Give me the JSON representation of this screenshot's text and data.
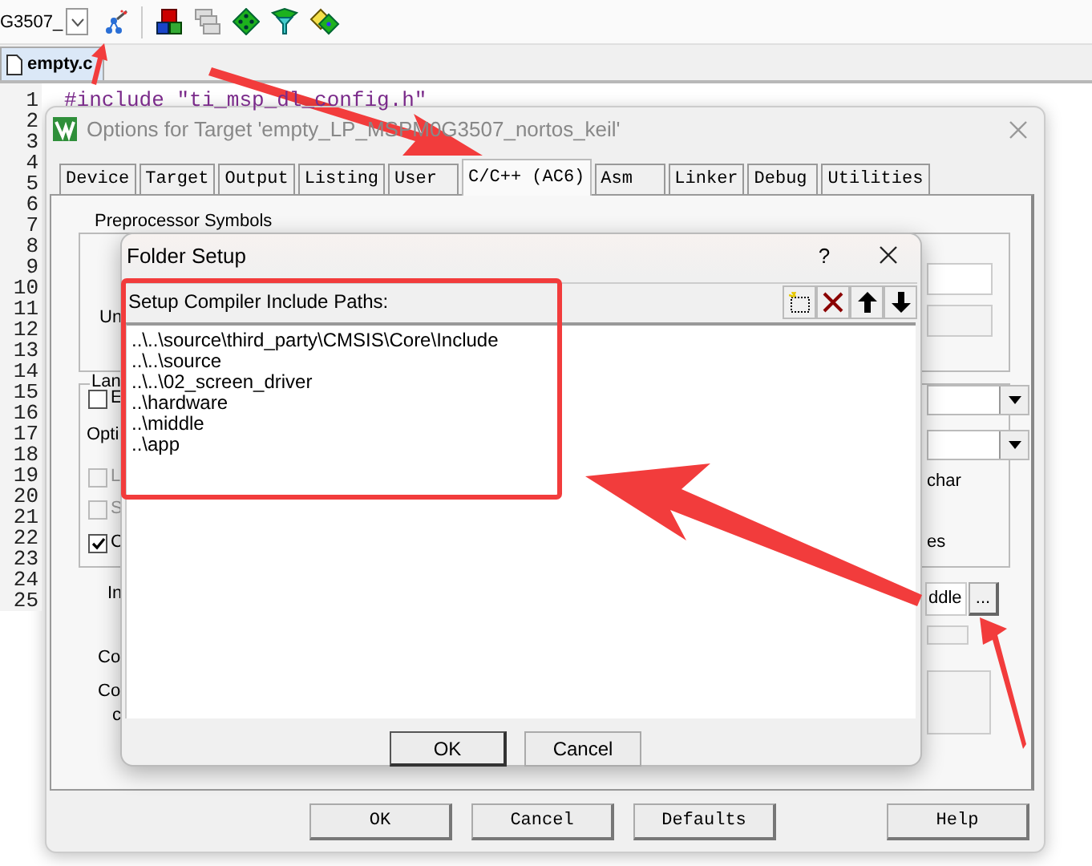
{
  "toolbar": {
    "target": "G3507_"
  },
  "editor": {
    "tab": {
      "label": "empty.c",
      "selected": true
    },
    "line_numbers": [
      "1",
      "2",
      "3",
      "4",
      "5",
      "6",
      "7",
      "8",
      "9",
      "10",
      "11",
      "12",
      "13",
      "14",
      "15",
      "16",
      "17",
      "18",
      "19",
      "20",
      "21",
      "22",
      "23",
      "24",
      "25"
    ],
    "code": [
      "#include \"ti_msp_dl_config.h\""
    ]
  },
  "options_dialog": {
    "title": "Options for Target 'empty_LP_MSPM0G3507_nortos_keil'",
    "tabs": [
      {
        "label": "Device",
        "selected": false
      },
      {
        "label": "Target",
        "selected": false
      },
      {
        "label": "Output",
        "selected": false
      },
      {
        "label": "Listing",
        "selected": false
      },
      {
        "label": "User",
        "selected": false
      },
      {
        "label": "C/C++ (AC6)",
        "selected": true
      },
      {
        "label": "Asm",
        "selected": false
      },
      {
        "label": "Linker",
        "selected": false
      },
      {
        "label": "Debug",
        "selected": false
      },
      {
        "label": "Utilities",
        "selected": false
      }
    ],
    "groups": [
      "Preprocessor Symbols",
      "Lan"
    ],
    "left_labels": [
      "Un",
      "Opti",
      "In",
      "Co",
      "Co",
      "c"
    ],
    "checkboxes": [
      {
        "label": "E",
        "checked": false,
        "disabled": false
      },
      {
        "label": "L",
        "checked": false,
        "disabled": true
      },
      {
        "label": "S",
        "checked": false,
        "disabled": true
      },
      {
        "label": "C",
        "checked": true,
        "disabled": false
      }
    ],
    "right_labels": [
      "char",
      "es"
    ],
    "include_field": {
      "value": "ddle"
    },
    "browse_button": "...",
    "buttons": [
      "OK",
      "Cancel",
      "Defaults",
      "Help"
    ]
  },
  "folder_dialog": {
    "title": "Folder Setup",
    "help": "?",
    "header": "Setup Compiler Include Paths:",
    "paths": [
      "..\\..\\source\\third_party\\CMSIS\\Core\\Include",
      "..\\..\\source",
      "..\\..\\02_screen_driver",
      "..\\hardware",
      "..\\middle",
      "..\\app"
    ],
    "buttons": [
      {
        "label": "OK",
        "selected": true
      },
      {
        "label": "Cancel",
        "selected": false
      }
    ]
  }
}
